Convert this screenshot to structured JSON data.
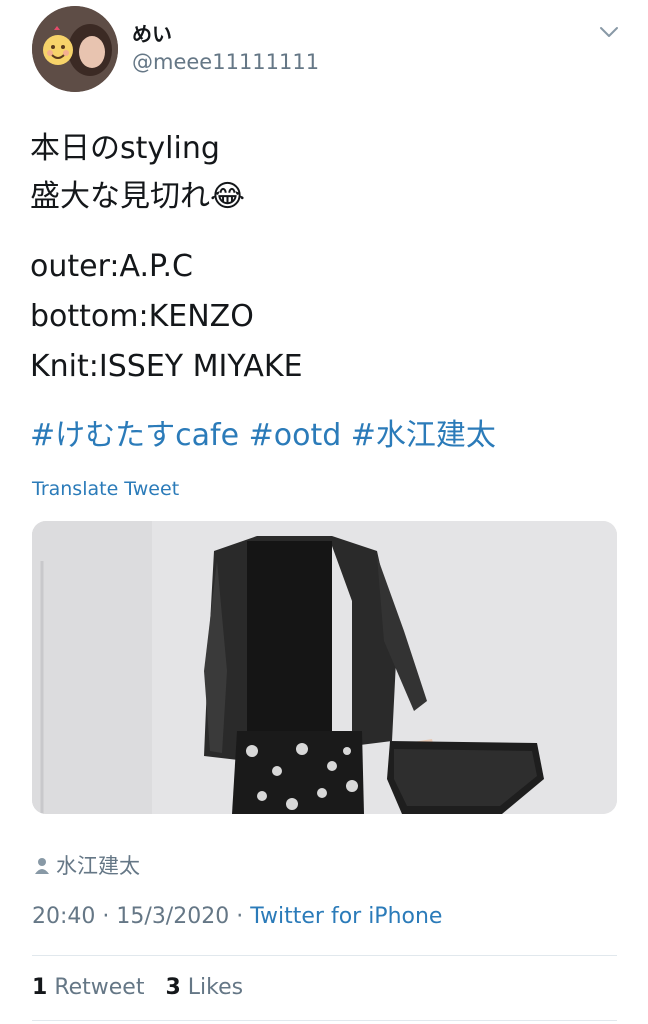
{
  "author": {
    "display_name": "めい",
    "handle": "@meee11111111",
    "avatar_icon": "avatar-photo"
  },
  "menu_icon": "chevron-down-icon",
  "tweet": {
    "lines": [
      "本日のstyling",
      "盛大な見切れ😂",
      "outer:A.P.C",
      "bottom:KENZO",
      "Knit:ISSEY MIYAKE"
    ],
    "hashtags": [
      "#けむたすcafe",
      "#ootd",
      "#水江建太"
    ],
    "translate_label": "Translate Tweet"
  },
  "media": {
    "kind": "photo"
  },
  "location": {
    "icon": "person-icon",
    "label": "水江建太"
  },
  "meta": {
    "time": "20:40",
    "date": "15/3/2020",
    "separator": "·",
    "source": "Twitter for iPhone"
  },
  "stats": {
    "retweets_count": "1",
    "retweets_label": "Retweet",
    "likes_count": "3",
    "likes_label": "Likes"
  },
  "colors": {
    "link": "#2b7bb9",
    "secondary": "#657786",
    "text": "#14171a"
  }
}
